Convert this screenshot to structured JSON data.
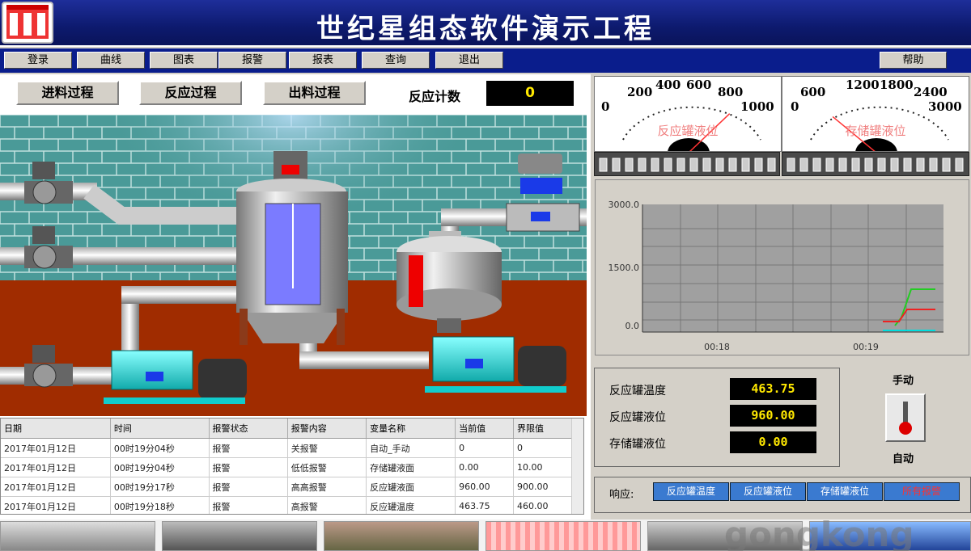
{
  "app": {
    "title": "世纪星组态软件演示工程"
  },
  "menu": [
    "登录",
    "曲线",
    "图表",
    "报警",
    "报表",
    "查询",
    "退出"
  ],
  "help": "帮助",
  "tabs": [
    "进料过程",
    "反应过程",
    "出料过程"
  ],
  "counter": {
    "label": "反应计数",
    "value": "0"
  },
  "gauges": [
    {
      "label": "反应罐液位",
      "ticks": [
        "0",
        "200",
        "400",
        "600",
        "800",
        "1000"
      ],
      "value_fraction": 0.96
    },
    {
      "label": "存储罐液位",
      "ticks": [
        "0",
        "600",
        "1200",
        "1800",
        "2400",
        "3000"
      ],
      "value_fraction": 0.0
    }
  ],
  "trend": {
    "y_ticks": [
      "3000.0",
      "1500.0",
      "0.0"
    ],
    "x_ticks": [
      "00:18",
      "00:19"
    ]
  },
  "readings": [
    {
      "label": "反应罐温度",
      "value": "463.75"
    },
    {
      "label": "反应罐液位",
      "value": "960.00"
    },
    {
      "label": "存储罐液位",
      "value": "0.00"
    }
  ],
  "switch": {
    "top": "手动",
    "bottom": "自动"
  },
  "response": {
    "label": "响应:",
    "buttons": [
      "反应罐温度",
      "反应罐液位",
      "存储罐液位",
      "所有报警"
    ]
  },
  "alarm_table": {
    "headers": [
      "日期",
      "时间",
      "报警状态",
      "报警内容",
      "变量名称",
      "当前值",
      "界限值"
    ],
    "rows": [
      [
        "2017年01月12日",
        "00时19分04秒",
        "报警",
        "关报警",
        "自动_手动",
        "0",
        "0"
      ],
      [
        "2017年01月12日",
        "00时19分04秒",
        "报警",
        "低低报警",
        "存储罐液面",
        "0.00",
        "10.00"
      ],
      [
        "2017年01月12日",
        "00时19分17秒",
        "报警",
        "高高报警",
        "反应罐液面",
        "960.00",
        "900.00"
      ],
      [
        "2017年01月12日",
        "00时19分18秒",
        "报警",
        "高报警",
        "反应罐温度",
        "463.75",
        "460.00"
      ]
    ]
  },
  "watermark": "gongkong",
  "colors": {
    "title_bar": "#0d1a6e",
    "display_text": "#ffe800",
    "alarm_button": "#ff3030"
  }
}
